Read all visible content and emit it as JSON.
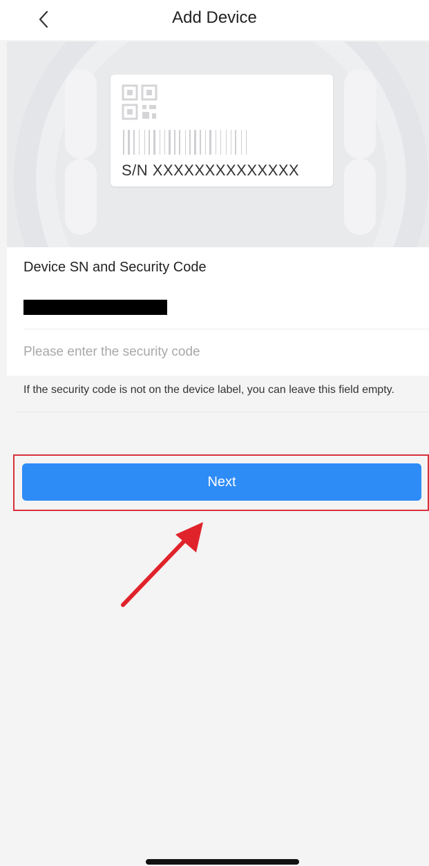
{
  "header": {
    "title": "Add Device",
    "back_icon": "chevron-left-icon"
  },
  "device_label": {
    "serial_text": "S/N  XXXXXXXXXXXXXX",
    "qr_icon": "qr-code-icon",
    "barcode_icon": "barcode-icon"
  },
  "form": {
    "section_title": "Device SN and Security Code",
    "security_code": {
      "value": "",
      "placeholder": "Please enter the security code"
    },
    "hint": "If the security code is not on the device label, you can leave this field empty."
  },
  "actions": {
    "next_label": "Next"
  },
  "colors": {
    "accent": "#2e8cf7",
    "annotation": "#d9303a",
    "background": "#f4f4f4"
  }
}
